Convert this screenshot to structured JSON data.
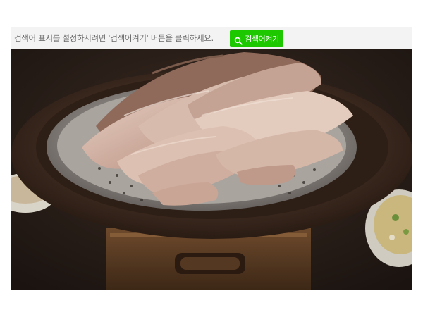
{
  "notice": {
    "text": "검색어 표시를 설정하시려면 '검색어켜기' 버튼을 클릭하세요."
  },
  "search_button": {
    "label": "검색어켜기",
    "icon": "search-icon",
    "color": "#1ec800"
  },
  "photo": {
    "subject": "steamed-pork-on-steamer-plate"
  }
}
